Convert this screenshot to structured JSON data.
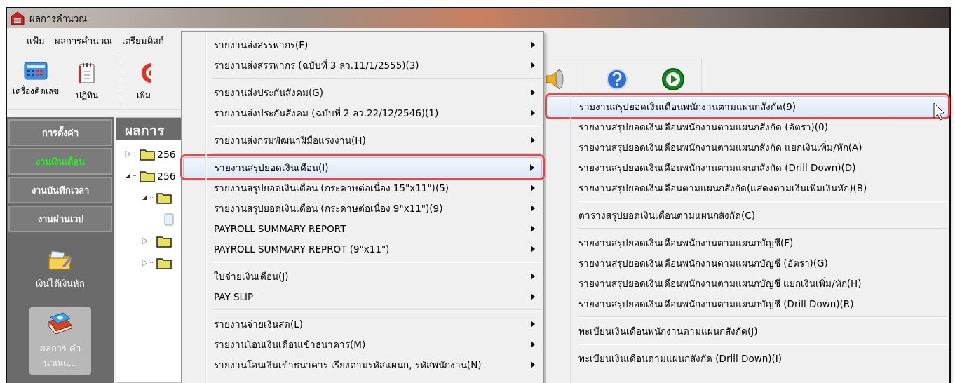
{
  "window": {
    "title": "ผลการคำนวณ"
  },
  "menu_bar": [
    {
      "label": "แฟ้ม"
    },
    {
      "label": "ผลการคำนวณ"
    },
    {
      "label": "เตรียมดิสก์"
    }
  ],
  "toolbar": {
    "left": [
      {
        "kind": "calculator",
        "label": "เครื่องคิดเลข"
      },
      {
        "kind": "calendar",
        "label": "ปฏิทิน"
      },
      {
        "kind": "add",
        "label": "เพิ่ม"
      }
    ],
    "right": [
      {
        "kind": "speaker"
      },
      {
        "kind": "help"
      },
      {
        "kind": "run"
      }
    ]
  },
  "sidebar": {
    "tabs": [
      {
        "label": "การตั้งค่า",
        "selected": false
      },
      {
        "label": "งานเงินเดือน",
        "selected": true
      },
      {
        "label": "งานบันทึกเวลา",
        "selected": false
      },
      {
        "label": "งานผ่านเวป",
        "selected": false
      }
    ],
    "items": [
      {
        "kind": "folder",
        "label": "เงินได้เงินหัก",
        "selected": false
      },
      {
        "kind": "book",
        "label": "ผลการ คำนวณแ...",
        "selected": true
      }
    ]
  },
  "tree": {
    "title": "ผลการ",
    "nodes": [
      {
        "label": "256",
        "expanded": false
      },
      {
        "label": "256",
        "expanded": true,
        "children": [
          {
            "expanded": true,
            "children": [
              {
                "kind": "item"
              }
            ]
          },
          {
            "expanded": false
          },
          {
            "expanded": false
          }
        ]
      }
    ]
  },
  "menu": {
    "groups": [
      [
        {
          "label": "รายงานส่งสรรพากร(F)",
          "selected": false
        },
        {
          "label": "รายงานส่งสรรพากร (ฉบับที่ 3 ลว.11/1/2555)(3)",
          "selected": false
        }
      ],
      [
        {
          "label": "รายงานส่งประกันสังคม(G)",
          "selected": false
        },
        {
          "label": "รายงานส่งประกันสังคม (ฉบับที่ 2 ลว.22/12/2546)(1)",
          "selected": false
        }
      ],
      [
        {
          "label": "รายงานส่งกรมพัฒนาฝีมือแรงงาน(H)",
          "selected": false
        }
      ],
      [
        {
          "label": "รายงานสรุปยอดเงินเดือน(I)",
          "selected": true
        },
        {
          "label": "รายงานสรุปยอดเงินเดือน (กระดาษต่อเนื่อง 15\"x11\")(5)",
          "selected": false
        },
        {
          "label": "รายงานสรุปยอดเงินเดือน (กระดาษต่อเนื่อง 9\"x11\")(9)",
          "selected": false
        },
        {
          "label": "PAYROLL SUMMARY REPORT",
          "selected": false
        },
        {
          "label": "PAYROLL SUMMARY REPROT (9\"x11\")",
          "selected": false
        }
      ],
      [
        {
          "label": "ใบจ่ายเงินเดือน(J)",
          "selected": false
        },
        {
          "label": "PAY SLIP",
          "selected": false
        }
      ],
      [
        {
          "label": "รายงานจ่ายเงินสด(L)",
          "selected": false
        },
        {
          "label": "รายงานโอนเงินเดือนเข้าธนาคาร(M)",
          "selected": false
        },
        {
          "label": "รายงานโอนเงินเข้าธนาคาร เรียงตามรหัสแผนก, รหัสพนักงาน(N)",
          "selected": false
        }
      ]
    ]
  },
  "submenu": {
    "groups": [
      [
        {
          "label": "รายงานสรุปยอดเงินเดือนพนักงานตามแผนกสังกัด(9)",
          "selected": true
        },
        {
          "label": "รายงานสรุปยอดเงินเดือนพนักงานตามแผนกสังกัด (อัตรา)(0)",
          "selected": false
        },
        {
          "label": "รายงานสรุปยอดเงินเดือนพนักงานตามแผนกสังกัด แยกเงินเพิ่ม/หัก(A)",
          "selected": false
        },
        {
          "label": "รายงานสรุปยอดเงินเดือนพนักงานตามแผนกสังกัด (Drill Down)(D)",
          "selected": false
        },
        {
          "label": "รายงานสรุปยอดเงินเดือนตามแผนกสังกัด(แสดงตามเงินเพิ่มเงินหัก)(B)",
          "selected": false
        }
      ],
      [
        {
          "label": "ตารางสรุปยอดเงินเดือนตามแผนกสังกัด(C)",
          "selected": false
        }
      ],
      [
        {
          "label": "รายงานสรุปยอดเงินเดือนพนักงานตามแผนกบัญชี(F)",
          "selected": false
        },
        {
          "label": "รายงานสรุปยอดเงินเดือนพนักงานตามแผนกบัญชี (อัตรา)(G)",
          "selected": false
        },
        {
          "label": "รายงานสรุปยอดเงินเดือนพนักงานตามแผนกบัญชี แยกเงินเพิ่ม/หัก(H)",
          "selected": false
        },
        {
          "label": "รายงานสรุปยอดเงินเดือนพนักงานตามแผนกบัญชี (Drill Down)(R)",
          "selected": false
        }
      ],
      [
        {
          "label": "ทะเบียนเงินเดือนพนักงานตามแผนกสังกัด(J)",
          "selected": false
        }
      ],
      [
        {
          "label": "ทะเบียนเงินเดือนตามแผนกสังกัด (Drill Down)(I)",
          "selected": false
        }
      ]
    ]
  }
}
